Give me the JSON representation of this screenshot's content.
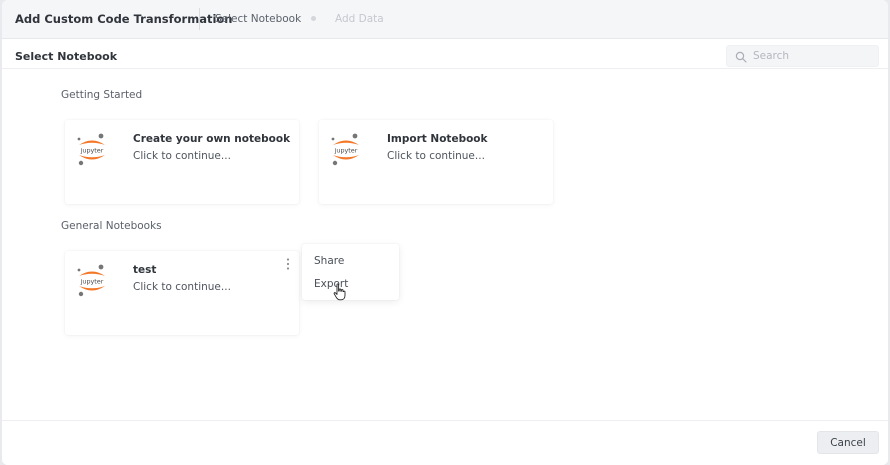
{
  "header": {
    "title": "Add Custom Code Transformation",
    "steps": [
      {
        "label": "Select Notebook",
        "state": "active"
      },
      {
        "label": "Add Data",
        "state": "disabled"
      }
    ]
  },
  "subheader": {
    "title": "Select Notebook",
    "search": {
      "placeholder": "Search",
      "value": ""
    }
  },
  "sections": {
    "getting_started": {
      "label": "Getting Started",
      "cards": [
        {
          "title": "Create your own notebook",
          "subtitle": "Click to continue...",
          "icon": "jupyter-icon"
        },
        {
          "title": "Import Notebook",
          "subtitle": "Click to continue...",
          "icon": "jupyter-icon"
        }
      ]
    },
    "general": {
      "label": "General Notebooks",
      "cards": [
        {
          "title": "test",
          "subtitle": "Click to continue...",
          "icon": "jupyter-icon"
        }
      ]
    }
  },
  "context_menu": {
    "items": [
      {
        "label": "Share"
      },
      {
        "label": "Export"
      }
    ]
  },
  "footer": {
    "cancel_label": "Cancel"
  },
  "colors": {
    "jupyter_orange": "#f37726",
    "jupyter_gray": "#767677",
    "header_bg": "#f5f6f8"
  }
}
